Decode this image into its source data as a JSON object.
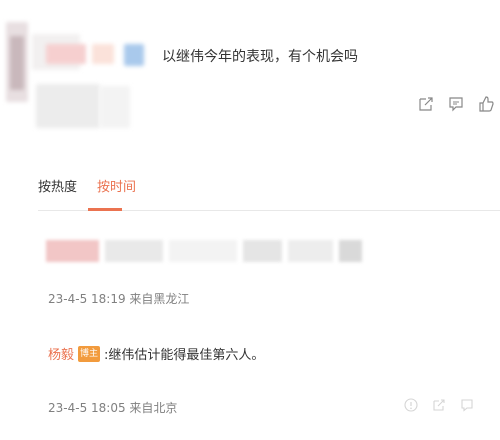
{
  "post": {
    "text": "以继伟今年的表现，有个机会吗",
    "actions": [
      "share-icon",
      "comment-icon",
      "like-icon"
    ]
  },
  "tabs": [
    {
      "label": "按热度",
      "active": false
    },
    {
      "label": "按时间",
      "active": true
    }
  ],
  "comment": {
    "meta": "23-4-5 18:19 来自黑龙江"
  },
  "reply": {
    "user": "杨毅",
    "badge": "博主",
    "text": ":继伟估计能得最佳第六人。",
    "meta": "23-4-5 18:05 来自北京",
    "actions": [
      "report-icon",
      "share-icon",
      "comment-icon"
    ]
  },
  "colors": {
    "accent": "#eb7350",
    "badge": "#f29b3d",
    "meta": "#808080"
  }
}
